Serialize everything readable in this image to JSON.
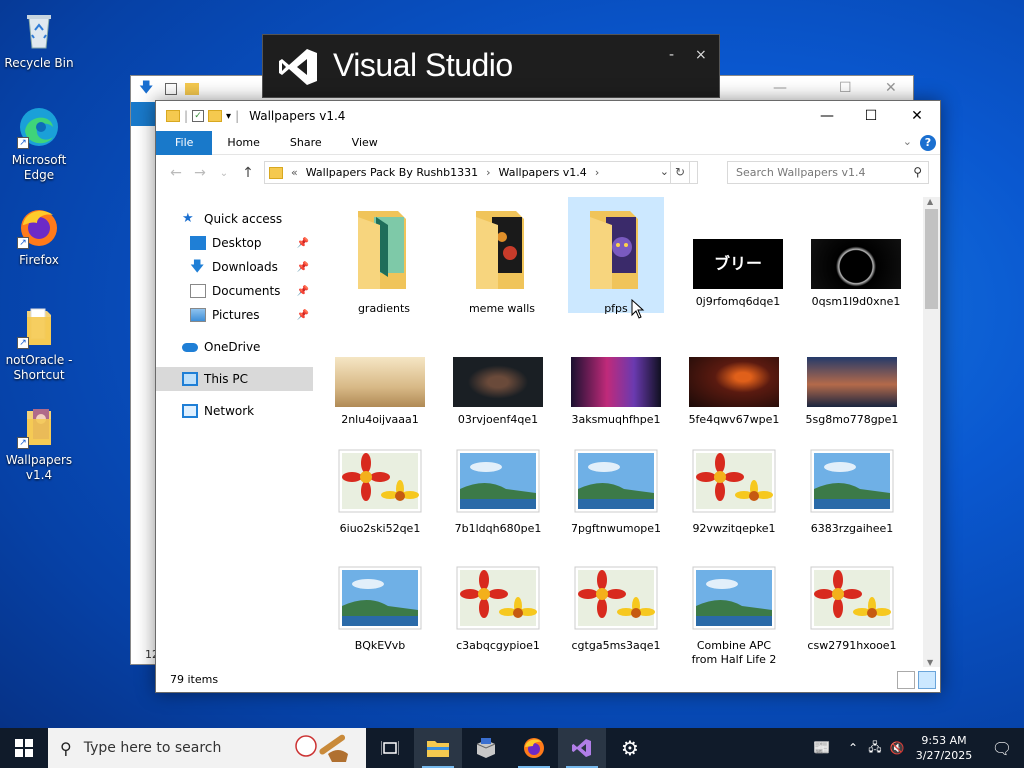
{
  "desktop": {
    "icons": [
      {
        "label": "Recycle Bin"
      },
      {
        "label": "Microsoft Edge"
      },
      {
        "label": "Firefox"
      },
      {
        "label": "notOracle - Shortcut"
      },
      {
        "label": "Wallpapers v1.4"
      }
    ]
  },
  "vs_splash": {
    "title": "Visual Studio",
    "minimize": "-",
    "close": "×"
  },
  "explorer": {
    "title": "Wallpapers v1.4",
    "controls": {
      "minimize": "—",
      "maximize": "☐",
      "close": "✕"
    },
    "ribbon": {
      "tabs": [
        "File",
        "Home",
        "Share",
        "View"
      ]
    },
    "address": {
      "prefix": "«",
      "crumbs": [
        "Wallpapers Pack By Rushb1331",
        "Wallpapers v1.4"
      ],
      "sep": "›"
    },
    "search_placeholder": "Search Wallpapers v1.4",
    "nav": {
      "quick_access": "Quick access",
      "desktop": "Desktop",
      "downloads": "Downloads",
      "documents": "Documents",
      "pictures": "Pictures",
      "onedrive": "OneDrive",
      "this_pc": "This PC",
      "network": "Network"
    },
    "items": [
      "gradients",
      "meme walls",
      "pfps",
      "0j9rfomq6dqe1",
      "0qsm1l9d0xne1",
      "2nlu4oijvaaa1",
      "03rvjoenf4qe1",
      "3aksmuqhfhpe1",
      "5fe4qwv67wpe1",
      "5sg8mo778gpe1",
      "6iuo2ski52qe1",
      "7b1ldqh680pe1",
      "7pgftnwumope1",
      "92vwzitqepke1",
      "6383rzgaihee1",
      "BQkEVvb",
      "c3abqcgypioe1",
      "cgtga5ms3aqe1",
      "Combine APC from Half Life 2",
      "csw2791hxooe1"
    ],
    "thumb_text": "ブリー",
    "status": "79 items"
  },
  "back_window": {
    "status": "12"
  },
  "taskbar": {
    "search_placeholder": "Type here to search",
    "time": "9:53 AM",
    "date": "3/27/2025"
  }
}
